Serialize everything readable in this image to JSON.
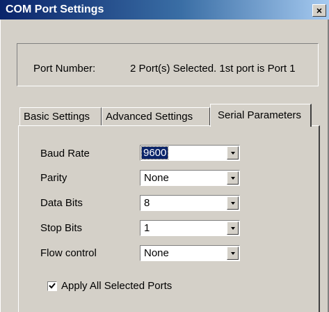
{
  "window": {
    "title": "COM Port Settings",
    "close_glyph": "×"
  },
  "port": {
    "label": "Port Number:",
    "value": "2 Port(s) Selected. 1st port is Port 1"
  },
  "tabs": [
    {
      "label": "Basic Settings",
      "selected": false
    },
    {
      "label": "Advanced Settings",
      "selected": false
    },
    {
      "label": "Serial Parameters",
      "selected": true
    }
  ],
  "serial": {
    "baud_rate": {
      "label": "Baud Rate",
      "value": "9600"
    },
    "parity": {
      "label": "Parity",
      "value": "None"
    },
    "data_bits": {
      "label": "Data Bits",
      "value": "8"
    },
    "stop_bits": {
      "label": "Stop Bits",
      "value": "1"
    },
    "flow_control": {
      "label": "Flow control",
      "value": "None"
    }
  },
  "apply_all": {
    "label": "Apply All Selected Ports",
    "checked": true
  },
  "colors": {
    "title_gradient_start": "#0a246a",
    "title_gradient_end": "#a6caf0",
    "face": "#d4d0c8",
    "selection": "#0a246a"
  }
}
